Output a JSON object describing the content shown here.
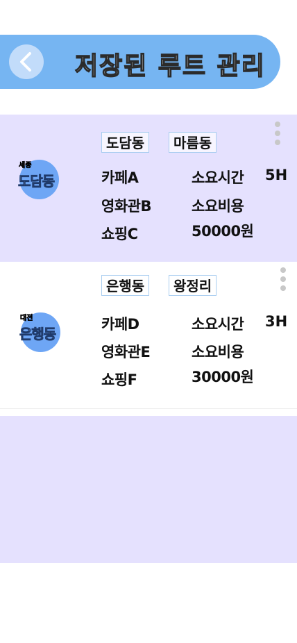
{
  "header": {
    "title": "저장된 루트 관리",
    "back_icon": "chevron-left-icon"
  },
  "routes": [
    {
      "region_city": "세종",
      "region_dong": "도담동",
      "tags": [
        "도담동",
        "마름동"
      ],
      "places": [
        "카페A",
        "영화관B",
        "쇼핑C"
      ],
      "time_label": "소요시간",
      "time_value": "5H",
      "cost_label": "소요비용",
      "cost_value": "50000원",
      "menu_icon": "more-vertical-icon"
    },
    {
      "region_city": "대전",
      "region_dong": "은행동",
      "tags": [
        "은행동",
        "왕정리"
      ],
      "places": [
        "카페D",
        "영화관E",
        "쇼핑F"
      ],
      "time_label": "소요시간",
      "time_value": "3H",
      "cost_label": "소요비용",
      "cost_value": "30000원",
      "menu_icon": "more-vertical-icon"
    }
  ],
  "colors": {
    "header_bg": "#76b5f2",
    "card_bg": "#e5e1fe",
    "badge_bg": "#6ea6f5"
  }
}
